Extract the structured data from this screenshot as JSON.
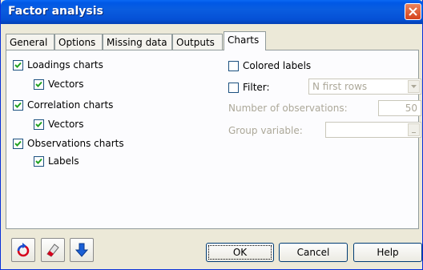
{
  "window": {
    "title": "Factor analysis"
  },
  "tabs": [
    {
      "label": "General"
    },
    {
      "label": "Options"
    },
    {
      "label": "Missing data"
    },
    {
      "label": "Outputs"
    },
    {
      "label": "Charts"
    }
  ],
  "charts": {
    "loadings": {
      "label": "Loadings charts",
      "checked": true
    },
    "loadings_vectors": {
      "label": "Vectors",
      "checked": true
    },
    "correlation": {
      "label": "Correlation charts",
      "checked": true
    },
    "correlation_vectors": {
      "label": "Vectors",
      "checked": true
    },
    "observations": {
      "label": "Observations charts",
      "checked": true
    },
    "observations_labels": {
      "label": "Labels",
      "checked": true
    },
    "colored_labels": {
      "label": "Colored labels",
      "checked": false
    },
    "filter": {
      "label": "Filter:",
      "checked": false,
      "option": "N first rows"
    },
    "num_obs": {
      "label": "Number of observations:",
      "value": "50"
    },
    "group_var": {
      "label": "Group variable:",
      "value": ""
    }
  },
  "buttons": {
    "ok": "OK",
    "cancel": "Cancel",
    "help": "Help"
  },
  "toolbar_icons": [
    "reset-icon",
    "eraser-icon",
    "down-arrow-icon"
  ]
}
